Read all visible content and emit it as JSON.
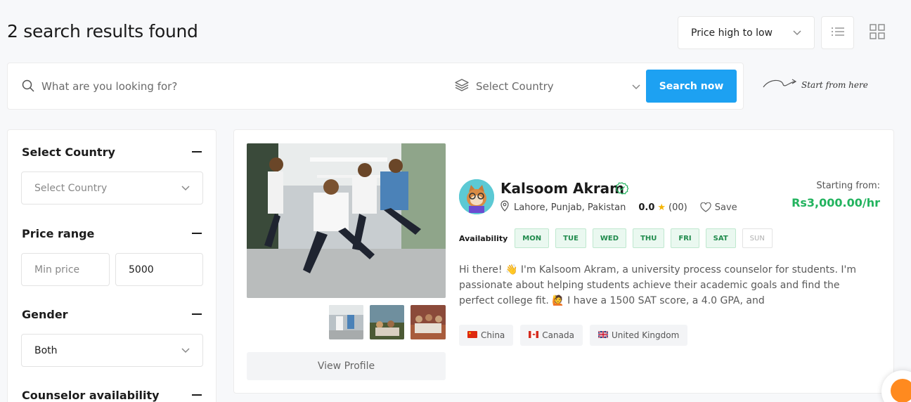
{
  "results": {
    "title": "2 search results found"
  },
  "sort": {
    "label": "Price high to low",
    "chevron": "chevron-down-icon"
  },
  "views": {
    "list": "list-view-icon",
    "grid": "grid-view-icon"
  },
  "search": {
    "placeholder": "What are you looking for?",
    "value": "",
    "country_placeholder": "Select Country",
    "button": "Search now",
    "hint": "Start from here"
  },
  "filters": {
    "country": {
      "heading": "Select Country",
      "placeholder": "Select Country"
    },
    "price": {
      "heading": "Price range",
      "min_placeholder": "Min price",
      "min_value": "",
      "max_value": "5000"
    },
    "gender": {
      "heading": "Gender",
      "value": "Both"
    },
    "availability": {
      "heading": "Counselor availability"
    }
  },
  "counselor": {
    "name": "Kalsoom Akram",
    "location": "Lahore, Punjab, Pakistan",
    "rating": "0.0",
    "review_count": "(00)",
    "save_label": "Save",
    "price_label": "Starting from:",
    "price": "Rs3,000.00/hr",
    "availability_label": "Availability",
    "days": [
      {
        "label": "MON",
        "available": true
      },
      {
        "label": "TUE",
        "available": true
      },
      {
        "label": "WED",
        "available": true
      },
      {
        "label": "THU",
        "available": true
      },
      {
        "label": "FRI",
        "available": true
      },
      {
        "label": "SAT",
        "available": true
      },
      {
        "label": "SUN",
        "available": false
      }
    ],
    "bio": "Hi there! 👋 I'm Kalsoom Akram, a university process counselor for students. I'm passionate about helping students achieve their academic goals and find the perfect college fit. 🙋 I have a 1500 SAT score, a 4.0 GPA, and",
    "countries": [
      {
        "name": "China",
        "flag": "china-flag-icon"
      },
      {
        "name": "Canada",
        "flag": "canada-flag-icon"
      },
      {
        "name": "United Kingdom",
        "flag": "uk-flag-icon"
      }
    ],
    "view_profile": "View Profile"
  },
  "colors": {
    "primary": "#1da1f2",
    "price": "#22b35e",
    "available_bg": "#eaf8f0",
    "available_text": "#1f8a4c",
    "fab": "#ff8a1f"
  }
}
